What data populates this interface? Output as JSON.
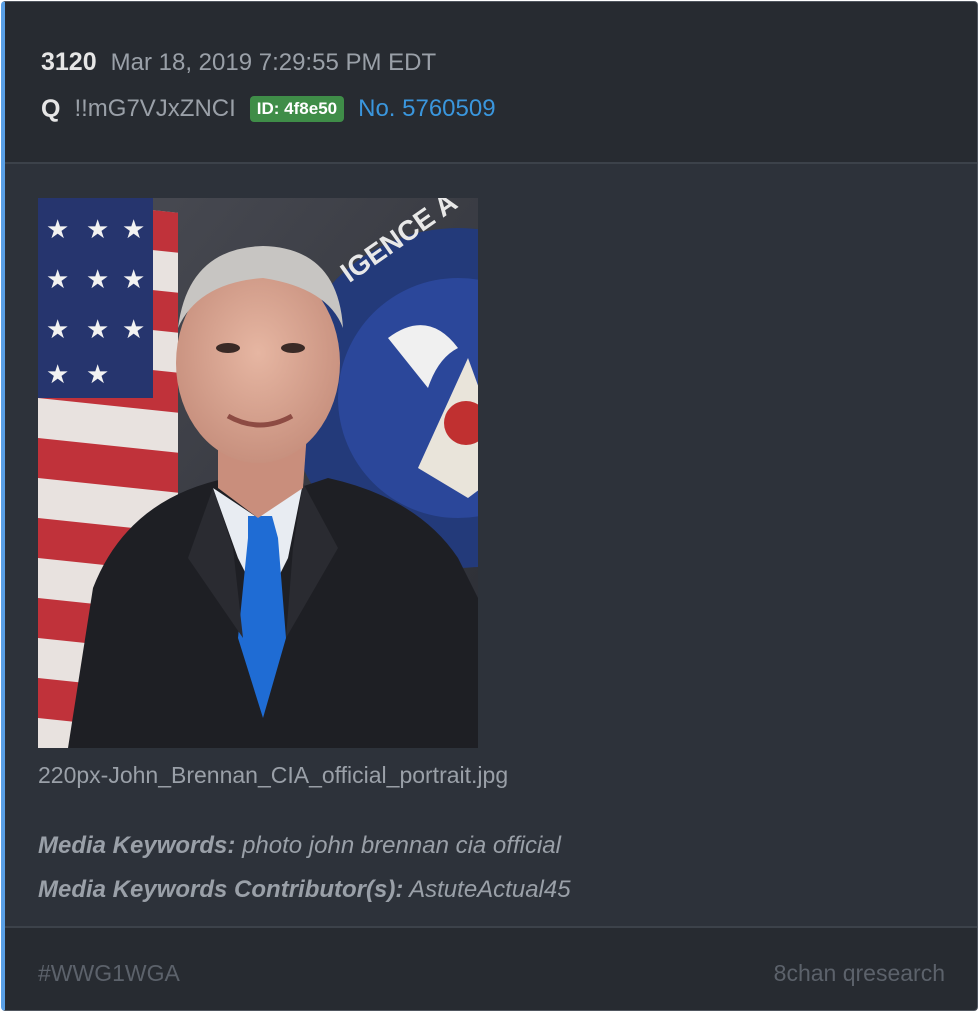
{
  "post": {
    "number": "3120",
    "date": "Mar 18, 2019 7:29:55 PM EDT",
    "author": "Q",
    "tripcode": "!!mG7VJxZNCI",
    "id_badge": "ID: 4f8e50",
    "post_no": "No. 5760509"
  },
  "media": {
    "filename": "220px-John_Brennan_CIA_official_portrait.jpg",
    "keywords_label": "Media Keywords:",
    "keywords_value": "photo john brennan cia official",
    "contributors_label": "Media Keywords Contributor(s):",
    "contributors_value": "AstuteActual45"
  },
  "footer": {
    "hashtag": "#WWG1WGA",
    "source": "8chan qresearch"
  },
  "colors": {
    "accent_border": "#5aa0e6",
    "id_badge": "#3f8d48",
    "link": "#3a96dd"
  }
}
